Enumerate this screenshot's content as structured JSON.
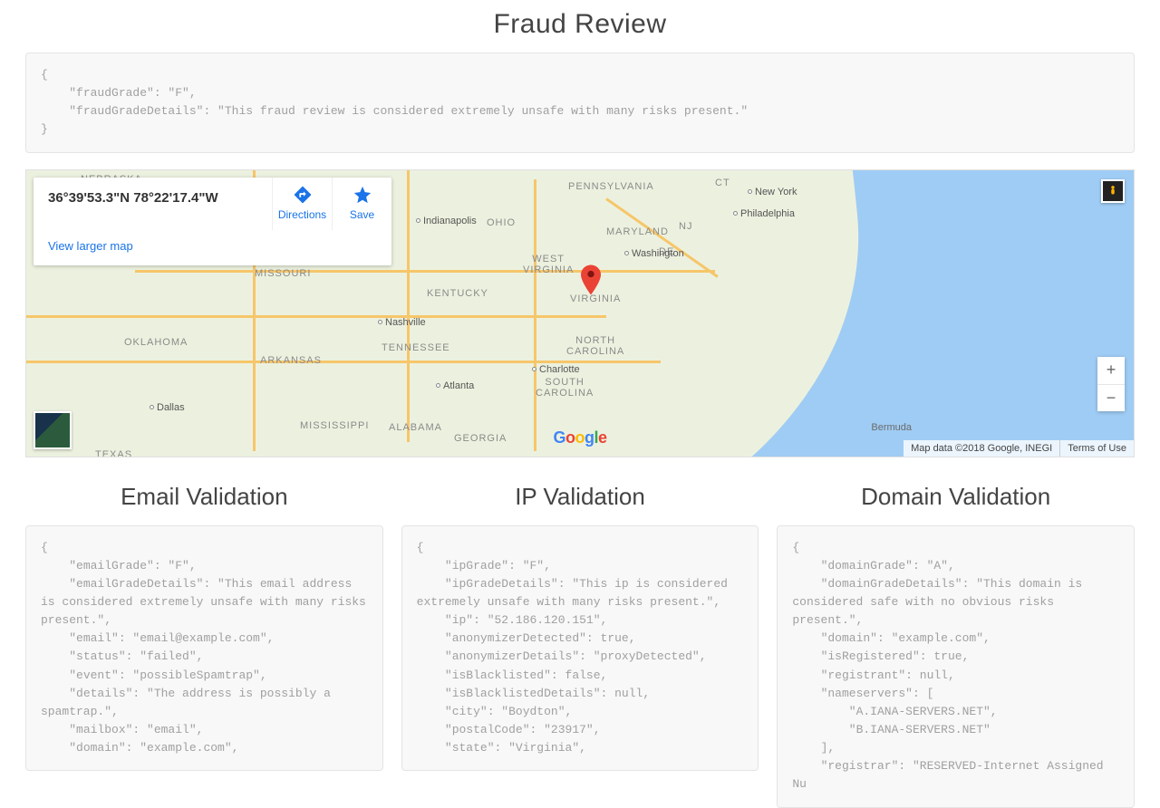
{
  "titles": {
    "fraud": "Fraud Review",
    "email": "Email Validation",
    "ip": "IP Validation",
    "domain": "Domain Validation"
  },
  "fraud_json": "{\n    \"fraudGrade\": \"F\",\n    \"fraudGradeDetails\": \"This fraud review is considered extremely unsafe with many risks present.\"\n}",
  "email_json": "{\n    \"emailGrade\": \"F\",\n    \"emailGradeDetails\": \"This email address is considered extremely unsafe with many risks present.\",\n    \"email\": \"email@example.com\",\n    \"status\": \"failed\",\n    \"event\": \"possibleSpamtrap\",\n    \"details\": \"The address is possibly a spamtrap.\",\n    \"mailbox\": \"email\",\n    \"domain\": \"example.com\",",
  "ip_json": "{\n    \"ipGrade\": \"F\",\n    \"ipGradeDetails\": \"This ip is considered extremely unsafe with many risks present.\",\n    \"ip\": \"52.186.120.151\",\n    \"anonymizerDetected\": true,\n    \"anonymizerDetails\": \"proxyDetected\",\n    \"isBlacklisted\": false,\n    \"isBlacklistedDetails\": null,\n    \"city\": \"Boydton\",\n    \"postalCode\": \"23917\",\n    \"state\": \"Virginia\",",
  "domain_json": "{\n    \"domainGrade\": \"A\",\n    \"domainGradeDetails\": \"This domain is considered safe with no obvious risks present.\",\n    \"domain\": \"example.com\",\n    \"isRegistered\": true,\n    \"registrant\": null,\n    \"nameservers\": [\n        \"A.IANA-SERVERS.NET\",\n        \"B.IANA-SERVERS.NET\"\n    ],\n    \"registrar\": \"RESERVED-Internet Assigned Nu",
  "map": {
    "coords": "36°39'53.3\"N 78°22'17.4\"W",
    "directions": "Directions",
    "save": "Save",
    "view_larger": "View larger map",
    "zoom_in": "+",
    "zoom_out": "−",
    "attr_data": "Map data ©2018 Google, INEGI",
    "attr_terms": "Terms of Use",
    "bermuda": "Bermuda",
    "cities": {
      "new_york": "New York",
      "philadelphia": "Philadelphia",
      "washington": "Washington",
      "charlotte": "Charlotte",
      "atlanta": "Atlanta",
      "nashville": "Nashville",
      "dallas": "Dallas",
      "indianapolis": "Indianapolis"
    },
    "states": {
      "nebraska": "NEBRASKA",
      "missouri": "MISSOURI",
      "arkansas": "ARKANSAS",
      "oklahoma": "OKLAHOMA",
      "texas": "TEXAS",
      "mississippi": "MISSISSIPPI",
      "alabama": "ALABAMA",
      "georgia": "GEORGIA",
      "tennessee": "TENNESSEE",
      "kentucky": "KENTUCKY",
      "ohio": "OHIO",
      "pennsylvania": "PENNSYLVANIA",
      "west_virginia": "WEST\nVIRGINIA",
      "virginia": "VIRGINIA",
      "north_carolina": "NORTH\nCAROLINA",
      "south_carolina": "SOUTH\nCAROLINA",
      "maryland": "MARYLAND",
      "ct": "CT",
      "nj": "NJ",
      "de": "DE"
    }
  }
}
